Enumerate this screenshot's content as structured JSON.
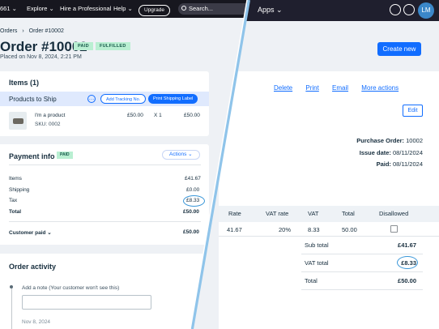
{
  "right_panel": {
    "topbar": {
      "apps_label": "Apps ⌄",
      "avatar_initials": "LM"
    },
    "create_button": "Create new",
    "actions": [
      "Delete",
      "Print",
      "Email",
      "More actions"
    ],
    "edit_button": "Edit",
    "purchase_order": {
      "po_label": "Purchase Order:",
      "po_value": "10002",
      "issue_label": "Issue date:",
      "issue_value": "08/11/2024",
      "paid_label": "Paid:",
      "paid_value": "08/11/2024"
    },
    "table": {
      "headers": [
        "Rate",
        "VAT rate",
        "VAT",
        "Total",
        "Disallowed"
      ],
      "row": [
        "41.67",
        "20%",
        "8.33",
        "50.00"
      ]
    },
    "totals": [
      {
        "label": "Sub total",
        "value": "£41.67"
      },
      {
        "label": "VAT total",
        "value": "£8.33"
      },
      {
        "label": "Total",
        "value": "£50.00"
      }
    ]
  },
  "left_panel": {
    "topbar": {
      "site": "661 ⌄",
      "explore": "Explore ⌄",
      "hire": "Hire a Professional",
      "help": "Help ⌄",
      "upgrade": "Upgrade",
      "search_placeholder": "Search..."
    },
    "breadcrumb": {
      "root": "Orders",
      "current": "Order #10002"
    },
    "title": "Order #10002",
    "badges": [
      "PAID",
      "FULFILLED"
    ],
    "placed": "Placed on Nov 8, 2024, 2:21 PM",
    "items_card": {
      "title": "Items (1)",
      "products_to_ship": "Products to Ship",
      "add_tracking": "Add Tracking No.",
      "print_label": "Print Shipping Label",
      "item_name": "I'm a product",
      "item_sku": "SKU: 0002",
      "item_price": "£50.00",
      "item_qty": "X 1",
      "item_total": "£50.00"
    },
    "payment_card": {
      "title": "Payment info",
      "badge": "PAID",
      "actions": "Actions ⌄",
      "rows": [
        {
          "label": "Items",
          "value": "£41.67"
        },
        {
          "label": "Shipping",
          "value": "£0.00"
        },
        {
          "label": "Tax",
          "value": "£8.33"
        },
        {
          "label": "Total",
          "value": "£50.00"
        }
      ],
      "customer_paid_label": "Customer paid ⌄",
      "customer_paid_value": "£50.00"
    },
    "activity_card": {
      "title": "Order activity",
      "note_placeholder": "Add a note (Your customer won't see this)",
      "date": "Nov 8, 2024"
    }
  }
}
